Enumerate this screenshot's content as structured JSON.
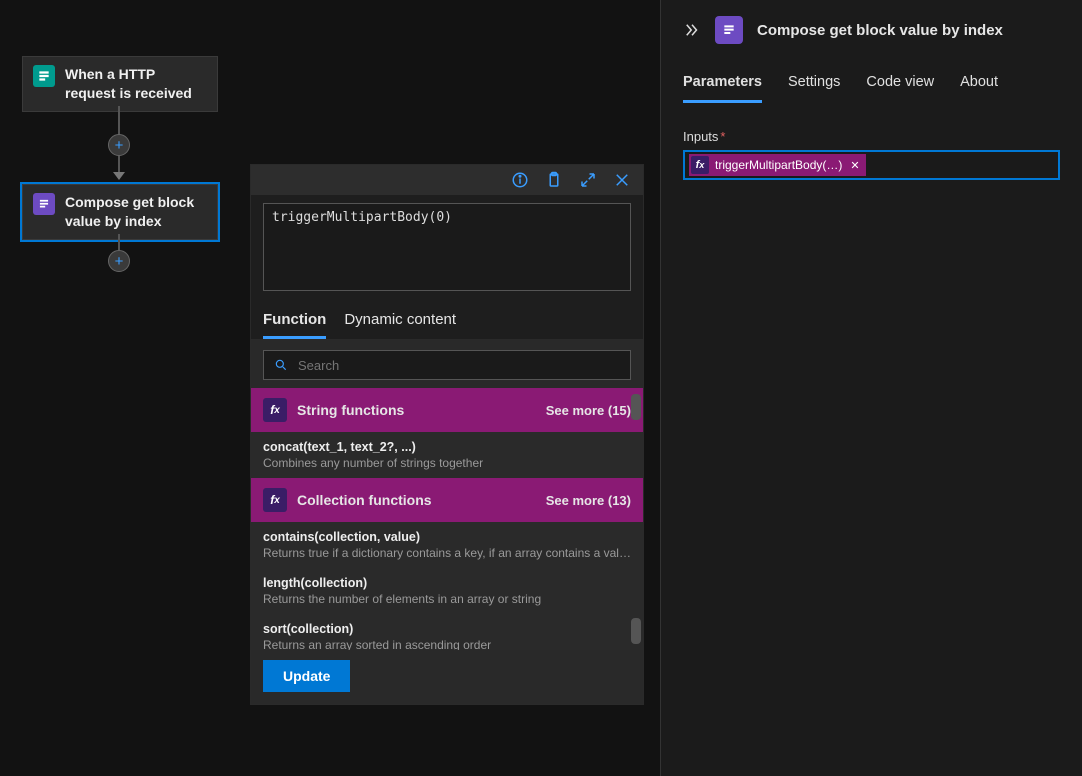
{
  "flow": {
    "trigger_title": "When a HTTP request is received",
    "action_title": "Compose get block value by index"
  },
  "popup": {
    "expression": "triggerMultipartBody(0)",
    "tabs": {
      "function": "Function",
      "dynamic": "Dynamic content"
    },
    "search_placeholder": "Search",
    "update_button": "Update",
    "categories": [
      {
        "title": "String functions",
        "see_more": "See more (15)",
        "items": [
          {
            "sig": "concat(text_1, text_2?, ...)",
            "desc": "Combines any number of strings together"
          }
        ]
      },
      {
        "title": "Collection functions",
        "see_more": "See more (13)",
        "items": [
          {
            "sig": "contains(collection, value)",
            "desc": "Returns true if a dictionary contains a key, if an array contains a val…"
          },
          {
            "sig": "length(collection)",
            "desc": "Returns the number of elements in an array or string"
          },
          {
            "sig": "sort(collection)",
            "desc": "Returns an array sorted in ascending order"
          }
        ]
      }
    ]
  },
  "panel": {
    "title": "Compose get block value by index",
    "tabs": {
      "parameters": "Parameters",
      "settings": "Settings",
      "code": "Code view",
      "about": "About"
    },
    "inputs_label": "Inputs",
    "token_text": "triggerMultipartBody(…)"
  }
}
